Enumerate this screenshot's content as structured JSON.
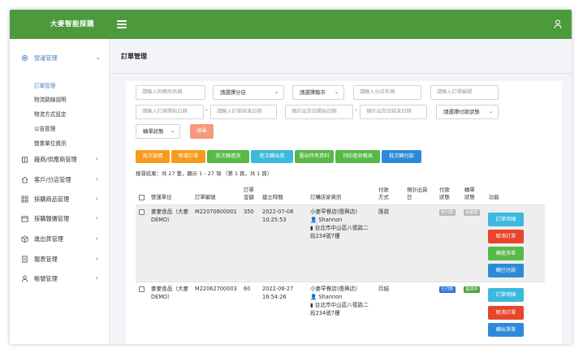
{
  "app": {
    "brand": "大麥智能採購"
  },
  "sidebar": {
    "groups": [
      {
        "label": "營運管理",
        "icon": "gear-icon"
      },
      {
        "label": "廠商/供應商管理",
        "icon": "building-icon"
      },
      {
        "label": "客戶/分店管理",
        "icon": "home-icon"
      },
      {
        "label": "採購商品管理",
        "icon": "grid-icon"
      },
      {
        "label": "採購報價管理",
        "icon": "calendar-icon"
      },
      {
        "label": "進出貨管理",
        "icon": "box-icon"
      },
      {
        "label": "報表管理",
        "icon": "document-icon"
      },
      {
        "label": "帳號管理",
        "icon": "user-icon"
      }
    ],
    "subitems": [
      "訂單管理",
      "物流路線說明",
      "物流方式設定",
      "公告管理",
      "營業單位資訊"
    ]
  },
  "page": {
    "title": "訂單管理"
  },
  "filters": {
    "supplier_ph": "請輸入供應商名稱",
    "branch_select": "請選擇分店",
    "city_select": "請選擇縣市",
    "store_ph": "請輸入分店名稱",
    "order_no_ph": "請輸入訂單編號",
    "order_start_ph": "請輸入訂單開始日期",
    "order_end_ph": "請輸入訂單結束日期",
    "ship_start_ph": "預計出貨日開始日期",
    "ship_end_ph": "預計出貨日結束日期",
    "payment_status_select": "請選擇付款狀態",
    "transfer_status_select": "轉單狀態",
    "search_label": "搜尋"
  },
  "actions": {
    "batch_transfer": "批次調價",
    "new_order": "新增訂單",
    "batch_receive": "批次轉進貨",
    "batch_ship": "批次轉出貨",
    "export_all": "匯出所有資料",
    "print_receipt": "列印進收報表",
    "batch_pay": "批次轉付款"
  },
  "results": {
    "summary": "搜尋結果：共 27 筆，顯示 1 - 27 項 （第 1 頁，共 1 頁）"
  },
  "table": {
    "headers": {
      "unit": "營運單位",
      "order_no": "訂單編號",
      "amount": "訂單\n金額",
      "created": "建立時間",
      "store": "訂購店家資訊",
      "pay_method": "付款\n方式",
      "ship_date": "預計出貨\n日",
      "pay_status": "付款\n狀態",
      "transfer_status": "轉單\n狀態",
      "functions": "功能"
    },
    "rows": [
      {
        "unit": "麥麥食品（大麥\nDEMO）",
        "order_no": "M22070800001",
        "amount": "350",
        "created": "2022-07-08\n10:25:53",
        "store_name": "小麥早餐店(復興店)",
        "contact": "Shannon",
        "address": "台北市中山區八德路二\n段234號7樓",
        "pay_method": "匯款",
        "pay_status": "未付款",
        "transfer_status": "未處理",
        "buttons": [
          "訂單明細",
          "取消訂單",
          "轉進貨單",
          "轉已付款"
        ]
      },
      {
        "unit": "麥麥食品（大麥\nDEMO）",
        "order_no": "M22062700003",
        "amount": "60",
        "created": "2022-06-27\n16:54:26",
        "store_name": "小麥早餐店(復興店)",
        "contact": "Shannon",
        "address": "台北市中山區八德路二\n段234號7樓",
        "pay_method": "月結",
        "pay_status": "已付款",
        "transfer_status": "進貨中",
        "buttons": [
          "訂單明細",
          "取消訂單",
          "轉出貨單"
        ]
      }
    ]
  }
}
